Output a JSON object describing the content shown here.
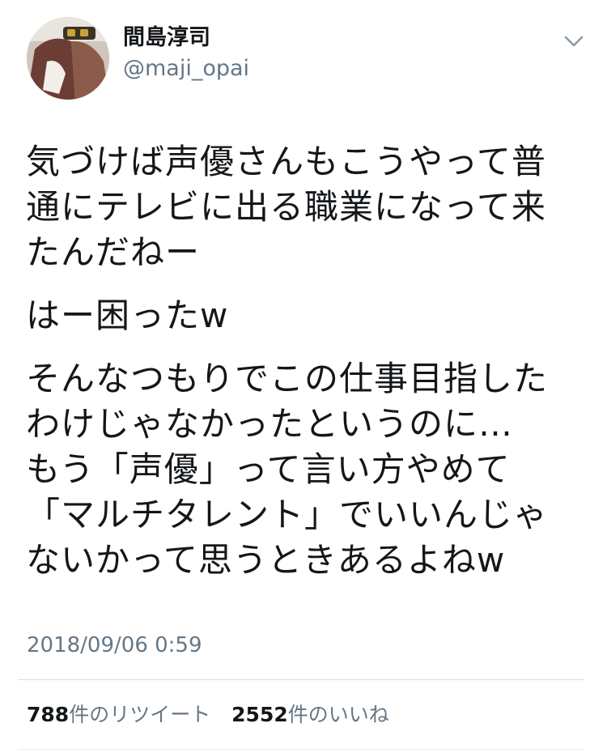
{
  "user": {
    "display_name": "間島淳司",
    "handle": "@maji_opai"
  },
  "tweet": {
    "paragraphs": [
      "気づけば声優さんもこうやって普\n通にテレビに出る職業になって来\nたんだねー",
      "はー困ったw",
      "そんなつもりでこの仕事目指した\nわけじゃなかったというのに…\nもう「声優」って言い方やめて\n「マルチタレント」でいいんじゃ\nないかって思うときあるよねw"
    ],
    "timestamp": "2018/09/06 0:59"
  },
  "stats": {
    "retweets_count": "788",
    "retweets_label": "件のリツイート",
    "likes_count": "2552",
    "likes_label": "件のいいね"
  }
}
